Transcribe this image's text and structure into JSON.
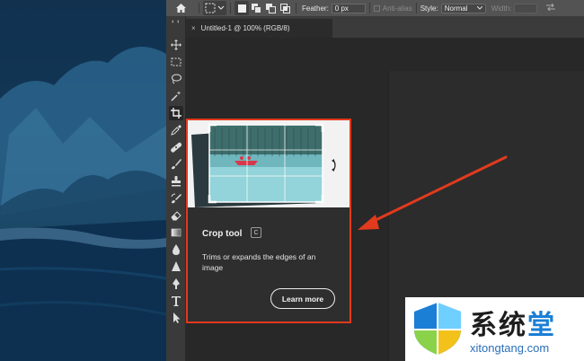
{
  "options_bar": {
    "feather_label": "Feather:",
    "feather_value": "0 px",
    "antialias_label": "Anti-alias",
    "style_label": "Style:",
    "style_value": "Normal",
    "width_label": "Width:"
  },
  "document_tab": {
    "close": "×",
    "title": "Untitled-1 @ 100% (RGB/8)"
  },
  "tools": [
    "move-tool",
    "marquee-tool",
    "lasso-tool",
    "magic-wand-tool",
    "crop-tool",
    "eyedropper-tool",
    "spot-healing-tool",
    "brush-tool",
    "clone-stamp-tool",
    "history-brush-tool",
    "eraser-tool",
    "gradient-tool",
    "blur-tool",
    "dodge-tool",
    "pen-tool",
    "type-tool",
    "path-selection-tool"
  ],
  "selected_tool": "crop-tool",
  "tooltip": {
    "title": "Crop tool",
    "shortcut": "C",
    "description": "Trims or expands the edges of an image",
    "learn_more": "Learn more"
  },
  "colors": {
    "highlight_border": "#e23a1d",
    "arrow": "#e23a1d",
    "options_bar": "#535353",
    "panel": "#3a3a3a"
  },
  "watermark": {
    "cn_text": "系统",
    "cn_accent": "堂",
    "url": "xitongtang.com"
  }
}
